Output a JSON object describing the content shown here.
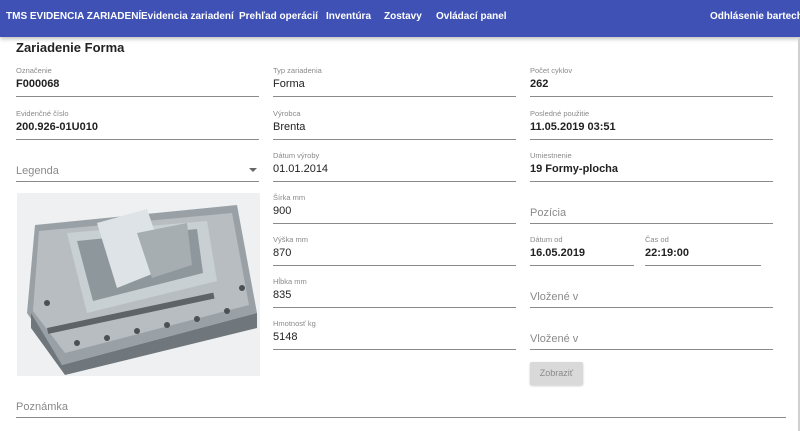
{
  "nav": {
    "brand": "TMS EVIDENCIA ZARIADENÍ",
    "items": [
      "Evidencia zariadení",
      "Prehľad operácií",
      "Inventúra",
      "Zostavy",
      "Ovládací panel"
    ],
    "logout": "Odhlásenie bartech",
    "color": "#3f51b5"
  },
  "page_title": "Zariadenie Forma",
  "left": {
    "oznacenie": {
      "label": "Označenie",
      "value": "F000068"
    },
    "evidencne": {
      "label": "Evidenčné číslo",
      "value": "200.926-01U010"
    },
    "legenda": {
      "placeholder": "Legenda"
    }
  },
  "middle": {
    "typ": {
      "label": "Typ zariadenia",
      "value": "Forma"
    },
    "vyrobca": {
      "label": "Výrobca",
      "value": "Brenta"
    },
    "datum_vyroby": {
      "label": "Dátum výroby",
      "value": "01.01.2014"
    },
    "sirka": {
      "label": "Šírka mm",
      "value": "900"
    },
    "vyska": {
      "label": "Výška mm",
      "value": "870"
    },
    "hlbka": {
      "label": "Hĺbka mm",
      "value": "835"
    },
    "hmotnost": {
      "label": "Hmotnosť kg",
      "value": "5148"
    }
  },
  "right": {
    "pocet_cyklov": {
      "label": "Počet cyklov",
      "value": "262"
    },
    "posledne": {
      "label": "Posledné použitie",
      "value": "11.05.2019 03:51"
    },
    "umiestnenie": {
      "label": "Umiestnenie",
      "value": "19 Formy-plocha"
    },
    "pozicia": {
      "placeholder": "Pozícia"
    },
    "datum_od": {
      "label": "Dátum od",
      "value": "16.05.2019"
    },
    "cas_od": {
      "label": "Čas od",
      "value": "22:19:00"
    },
    "vlozene1": {
      "placeholder": "Vložené v"
    },
    "vlozene2": {
      "placeholder": "Vložené v"
    },
    "zobrazit": "Zobraziť"
  },
  "poznamka": {
    "placeholder": "Poznámka"
  },
  "photo": {
    "icon": "mold-photo"
  }
}
